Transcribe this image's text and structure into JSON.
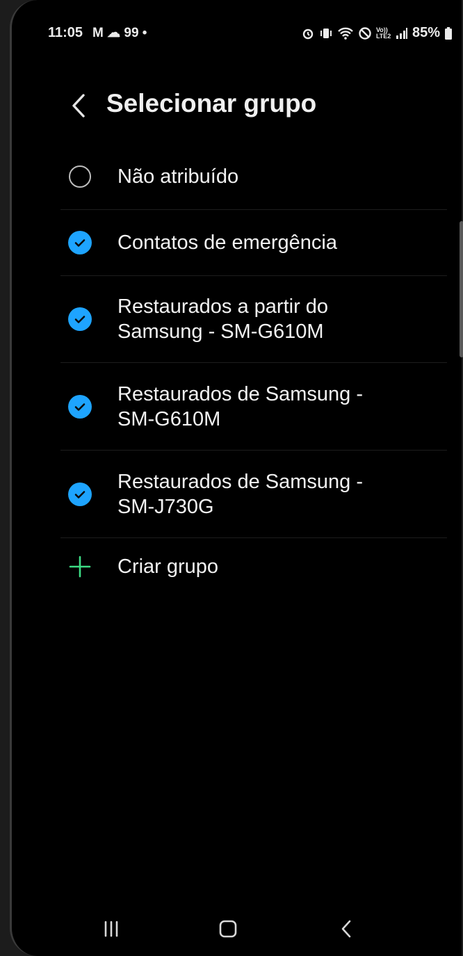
{
  "status_bar": {
    "time": "11:05",
    "left_icons": "M ☁ 99 •",
    "right_icons": [
      "alarm-icon",
      "vibrate-icon",
      "wifi-icon",
      "blocked-icon",
      "volte-icon",
      "signal-icon"
    ],
    "volte_text": "Vo)) LTE2",
    "battery": "85%"
  },
  "header": {
    "title": "Selecionar grupo",
    "back_icon": "chevron-left-icon"
  },
  "groups": [
    {
      "label_lines": [
        "Não atribuído"
      ],
      "selected": false,
      "control": "radio"
    },
    {
      "label_lines": [
        "Contatos de emergência"
      ],
      "selected": true,
      "control": "checkbox"
    },
    {
      "label_lines": [
        "Restaurados a partir do",
        "Samsung - SM-G610M"
      ],
      "selected": true,
      "control": "checkbox"
    },
    {
      "label_lines": [
        "Restaurados de Samsung -",
        "SM-G610M"
      ],
      "selected": true,
      "control": "checkbox"
    },
    {
      "label_lines": [
        "Restaurados de Samsung -",
        "SM-J730G"
      ],
      "selected": true,
      "control": "checkbox"
    }
  ],
  "create_group": {
    "label": "Criar grupo",
    "icon": "plus-icon"
  },
  "nav": {
    "recents_icon": "recents-icon",
    "home_icon": "home-icon",
    "back_icon": "back-icon"
  },
  "colors": {
    "accent": "#1ea4ff",
    "plus": "#3ddc84",
    "background": "#000000"
  }
}
